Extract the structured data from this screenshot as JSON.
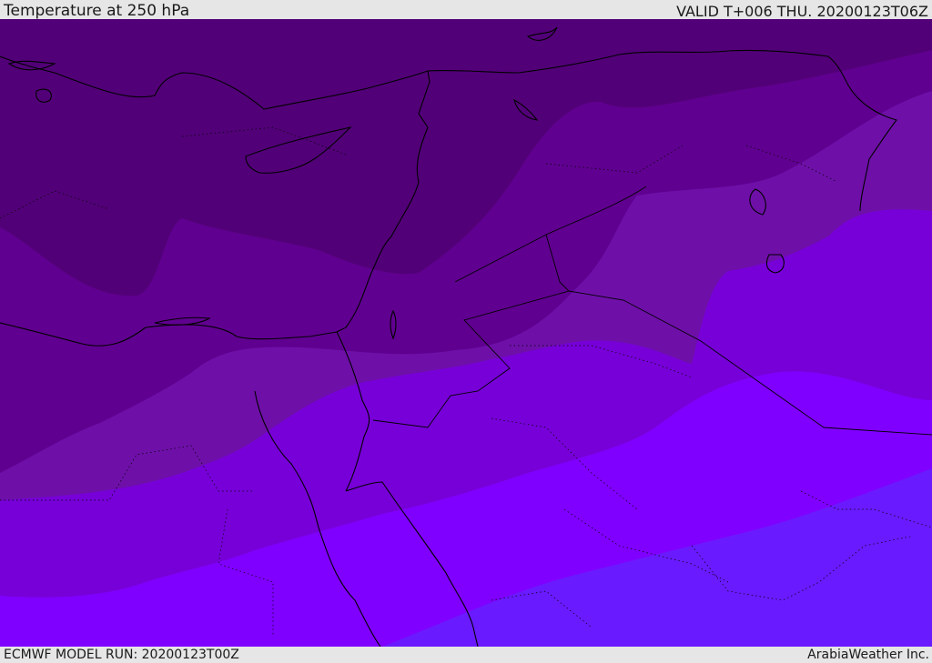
{
  "header": {
    "title": "Temperature at 250 hPa",
    "valid": "VALID T+006 THU. 20200123T06Z"
  },
  "footer": {
    "model_run": "ECMWF MODEL RUN: 20200123T00Z",
    "brand": "ArabiaWeather Inc."
  },
  "colors": {
    "band_1_coldest": "#520078",
    "band_2": "#600090",
    "band_3": "#6e10a8",
    "band_4": "#7700d8",
    "band_5": "#8000ff",
    "band_6_warmest": "#6a1aff",
    "coastline": "#000000",
    "bar_background": "#e6e6e6"
  }
}
